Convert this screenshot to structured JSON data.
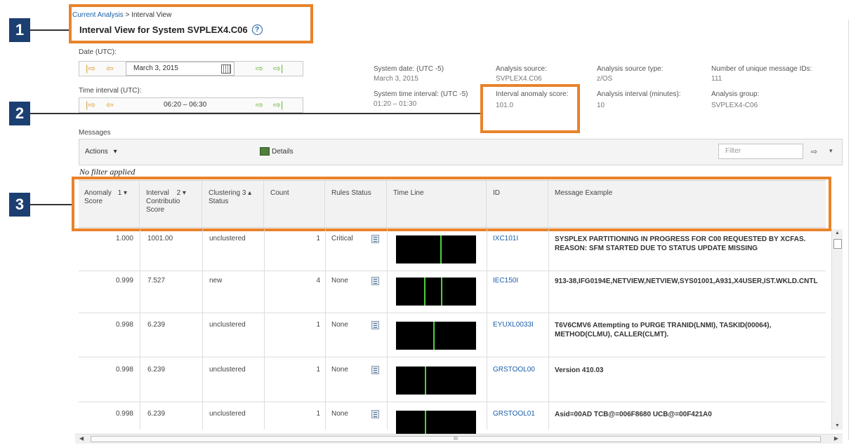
{
  "callouts": [
    "1",
    "2",
    "3"
  ],
  "breadcrumb": {
    "link": "Current Analysis",
    "separator": ">",
    "current": "Interval View"
  },
  "title": "Interval View for System SVPLEX4.C06",
  "help_icon": "?",
  "date": {
    "label": "Date (UTC):",
    "value": "March 3, 2015"
  },
  "interval": {
    "label": "Time interval (UTC):",
    "value": "06:20 – 06:30"
  },
  "info": {
    "system_date_label": "System date: (UTC -5)",
    "system_date_value": "March 3, 2015",
    "system_interval_label": "System time interval: (UTC -5)",
    "system_interval_value": "01:20 – 01:30",
    "analysis_source_label": "Analysis source:",
    "analysis_source_value": "SVPLEX4.C06",
    "anomaly_score_label": "Interval anomaly score:",
    "anomaly_score_value": "101.0",
    "source_type_label": "Analysis source type:",
    "source_type_value": "z/OS",
    "analysis_interval_label": "Analysis interval (minutes):",
    "analysis_interval_value": "10",
    "unique_ids_label": "Number of unique message IDs:",
    "unique_ids_value": "111",
    "analysis_group_label": "Analysis group:",
    "analysis_group_value": "SVPLEX4-C06"
  },
  "messages": {
    "section_label": "Messages",
    "actions_label": "Actions",
    "details_label": "Details",
    "filter_placeholder": "Filter",
    "filter_status": "No filter applied"
  },
  "columns": [
    {
      "line1": "Anomaly",
      "line2": "Score",
      "line3": "",
      "sort": "1 ▾"
    },
    {
      "line1": "Interval",
      "line2": "Contributio",
      "line3": "Score",
      "sort": "2 ▾"
    },
    {
      "line1": "Clustering",
      "line2": "Status",
      "line3": "",
      "sort": "3 ▴"
    },
    {
      "line1": "Count",
      "line2": "",
      "line3": "",
      "sort": ""
    },
    {
      "line1": "Rules Status",
      "line2": "",
      "line3": "",
      "sort": ""
    },
    {
      "line1": "Time Line",
      "line2": "",
      "line3": "",
      "sort": ""
    },
    {
      "line1": "ID",
      "line2": "",
      "line3": "",
      "sort": ""
    },
    {
      "line1": "Message Example",
      "line2": "",
      "line3": "",
      "sort": ""
    }
  ],
  "rows": [
    {
      "score": "1.000",
      "contribution": "1001.00",
      "clustering": "unclustered",
      "count": "1",
      "rules": "Critical",
      "id": "IXC101I",
      "message_line1": "SYSPLEX PARTITIONING IN PROGRESS FOR C00 REQUESTED BY XCFAS.",
      "message_line2": "REASON: SFM STARTED DUE TO STATUS UPDATE MISSING",
      "ticks": [
        0.56
      ]
    },
    {
      "score": "0.999",
      "contribution": "7.527",
      "clustering": "new",
      "count": "4",
      "rules": "None",
      "id": "IEC150I",
      "message_line1": "913-38,IFG0194E,NETVIEW,NETVIEW,SYS01001,A931,X4USER,IST.WKLD.CNTL",
      "message_line2": "",
      "ticks": [
        0.36,
        0.57
      ]
    },
    {
      "score": "0.998",
      "contribution": "6.239",
      "clustering": "unclustered",
      "count": "1",
      "rules": "None",
      "id": "EYUXL0033I",
      "message_line1": "T6V6CMV6 Attempting to PURGE TRANID(LNMI), TASKID(00064),",
      "message_line2": "METHOD(CLMU), CALLER(CLMT).",
      "ticks": [
        0.47
      ]
    },
    {
      "score": "0.998",
      "contribution": "6.239",
      "clustering": "unclustered",
      "count": "1",
      "rules": "None",
      "id": "GRSTOOL00",
      "message_line1": "Version 410.03",
      "message_line2": "",
      "ticks": [
        0.37
      ]
    },
    {
      "score": "0.998",
      "contribution": "6.239",
      "clustering": "unclustered",
      "count": "1",
      "rules": "None",
      "id": "GRSTOOL01",
      "message_line1": "Asid=00AD TCB@=006F8680 UCB@=00F421A0",
      "message_line2": "",
      "ticks": [
        0.37
      ]
    }
  ],
  "scroll_indicator": "III",
  "colors": {
    "callout_bg": "#1c3f72",
    "highlight": "#e8832a",
    "link": "#1a5ea8",
    "timeline_bg": "#000000",
    "timeline_tick": "#4cd23a"
  }
}
